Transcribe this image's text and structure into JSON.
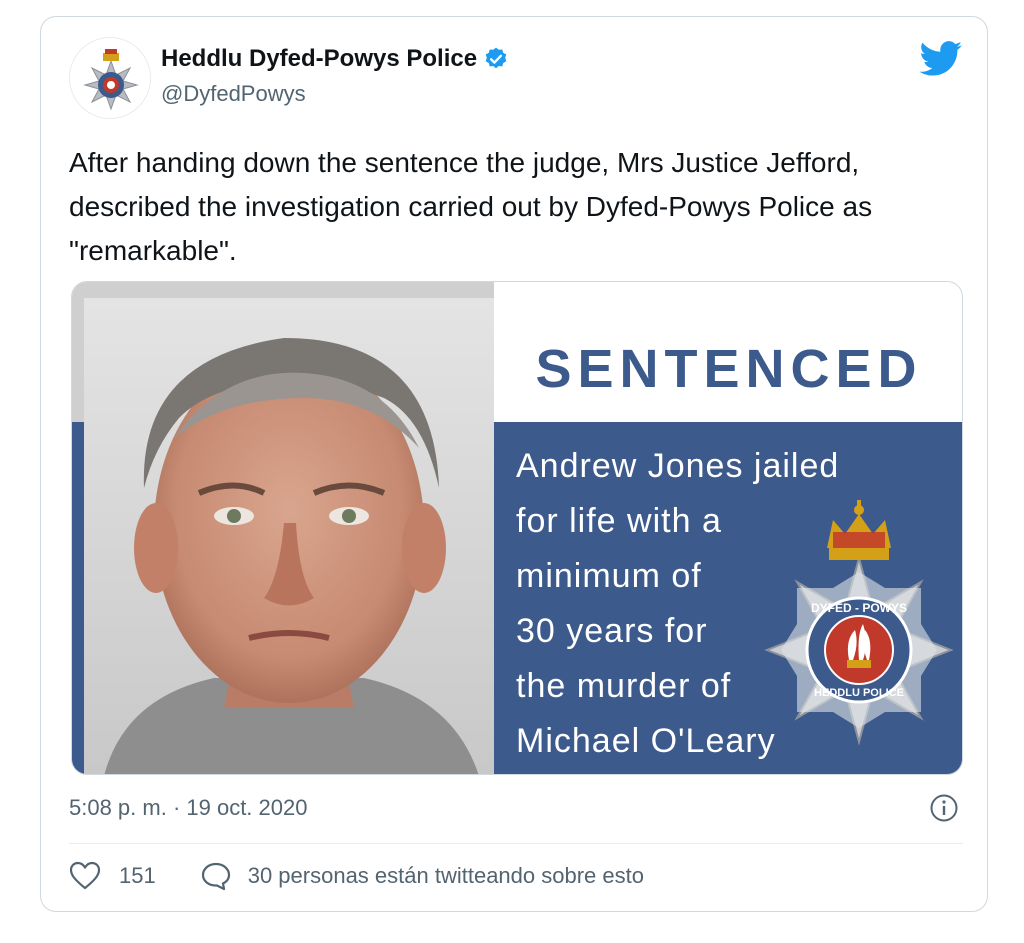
{
  "account": {
    "display_name": "Heddlu Dyfed-Powys Police",
    "handle": "@DyfedPowys",
    "verified": true
  },
  "tweet": {
    "text": "After handing down the sentence the judge, Mrs Justice Jefford, described the investigation carried out by Dyfed-Powys Police as \"remarkable\".",
    "timestamp": "5:08 p. m. · 19 oct. 2020"
  },
  "media": {
    "headline": "SENTENCED",
    "caption_lines": [
      "Andrew Jones jailed",
      "for life with a",
      "minimum of",
      "30 years for",
      "the murder of",
      "Michael O'Leary"
    ],
    "badge_text_top": "DYFED - POWYS",
    "badge_text_bottom": "HEDDLU POLICE"
  },
  "engagement": {
    "likes": "151",
    "talking": "30 personas están twitteando sobre esto"
  },
  "colors": {
    "brand_blue": "#3d5a8c",
    "twitter_blue": "#1d9bf0",
    "muted": "#536471"
  },
  "icons": [
    "police-badge-icon",
    "verified-icon",
    "twitter-bird-icon",
    "info-icon",
    "heart-icon",
    "speech-bubble-icon"
  ]
}
